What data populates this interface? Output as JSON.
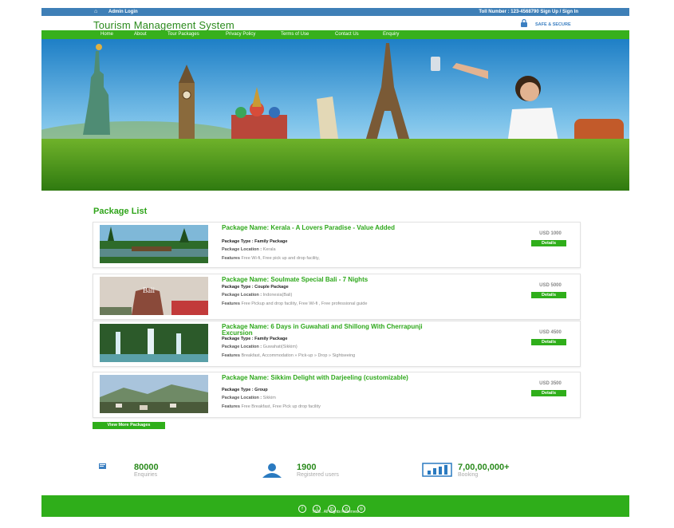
{
  "topbar": {
    "admin_login": "Admin Login",
    "toll_text": "Toll Number : 123-4568790   Sign Up / Sign In"
  },
  "header": {
    "brand": "Tourism Management System",
    "safe": "SAFE & SECURE"
  },
  "nav": [
    "Home",
    "About",
    "Tour Packages",
    "Privacy Policy",
    "Terms of Use",
    "Contact Us",
    "Enquiry"
  ],
  "package_list_title": "Package List",
  "labels": {
    "type": "Package Type : ",
    "location": "Package Location : ",
    "features": "Features "
  },
  "packages": [
    {
      "name": "Package Name: Kerala - A Lovers Paradise - Value Added",
      "type": "Family Package",
      "location": "Kerala",
      "features": "Free Wi-fi, Free pick up and drop facility,",
      "price": "USD 1000",
      "details": "Details"
    },
    {
      "name": "Package Name: Soulmate Special Bali - 7 Nights",
      "type": "Couple Package",
      "location": "Indonesia(Bali)",
      "features": "Free Pickup and drop facility, Free Wi-fi , Free professional guide",
      "price": "USD 5000",
      "details": "Details",
      "thumb_text": "Bali"
    },
    {
      "name": "Package Name: 6 Days in Guwahati and Shillong With Cherrapunji Excursion",
      "type": "Family Package",
      "location": "Guwahati(Sikkim)",
      "features": "Breakfast, Accommodation » Pick-up » Drop » Sightseeing",
      "price": "USD 4500",
      "details": "Details"
    },
    {
      "name": "Package Name: Sikkim Delight with Darjeeling (customizable)",
      "type": "Group",
      "location": "Sikkim",
      "features": "Free Breakfast, Free Pick up drop facility",
      "price": "USD 3500",
      "details": "Details"
    }
  ],
  "view_more": "View More Packages",
  "stats": [
    {
      "value": "80000",
      "label": "Enquiries",
      "icon": "enquiry-icon"
    },
    {
      "value": "1900",
      "label": "Registered users",
      "icon": "user-icon"
    },
    {
      "value": "7,00,00,000+",
      "label": "Booking",
      "icon": "bar-chart-icon"
    }
  ],
  "footer": {
    "copyright": "TMS . All Rights Reserved"
  },
  "colors": {
    "topbar": "#3e7fb7",
    "nav": "#37b01c",
    "accent": "#2fae1a",
    "brand": "#2a8a1c"
  }
}
